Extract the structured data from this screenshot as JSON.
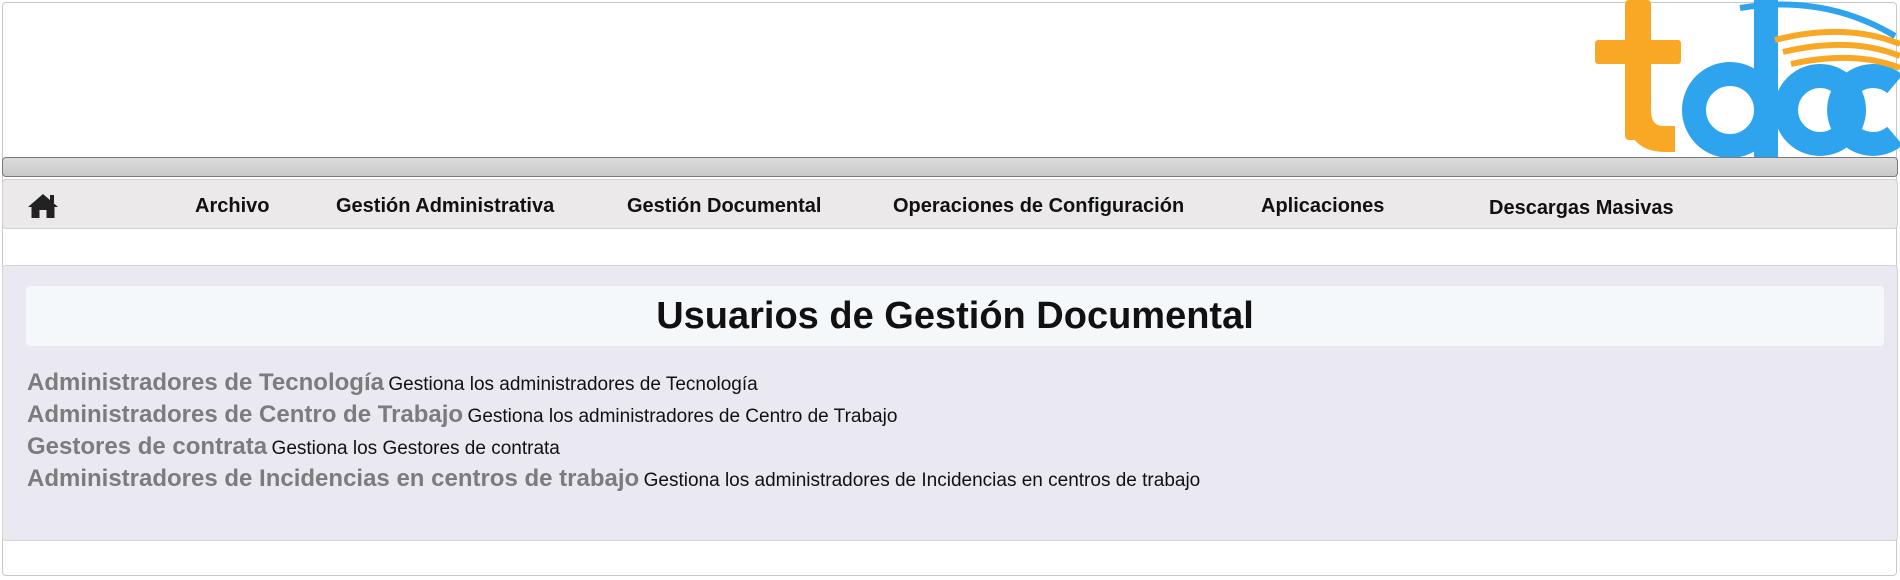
{
  "brand": {
    "logo_text": "tdoc",
    "colors": {
      "t": "#f9a826",
      "doc": "#2ea3ee",
      "swoosh": "#f9a826"
    }
  },
  "nav": {
    "home_icon": "home-icon",
    "items": [
      {
        "label": "Archivo"
      },
      {
        "label": "Gestión Administrativa"
      },
      {
        "label": "Gestión Documental"
      },
      {
        "label": "Operaciones de Configuración"
      },
      {
        "label": "Aplicaciones"
      },
      {
        "label": "Descargas Masivas"
      }
    ]
  },
  "main": {
    "title": "Usuarios de Gestión Documental",
    "links": [
      {
        "title": "Administradores de Tecnología",
        "description": "Gestiona los administradores de Tecnología"
      },
      {
        "title": "Administradores de Centro de Trabajo",
        "description": "Gestiona los administradores de Centro de Trabajo"
      },
      {
        "title": "Gestores de contrata",
        "description": "Gestiona los Gestores de contrata"
      },
      {
        "title": "Administradores de Incidencias en centros de trabajo",
        "description": "Gestiona los administradores de Incidencias en centros de trabajo"
      }
    ]
  },
  "colors": {
    "content_bg": "#eae9f2",
    "nav_bg": "#ebe9e9",
    "link_title": "#7c7c7c"
  }
}
